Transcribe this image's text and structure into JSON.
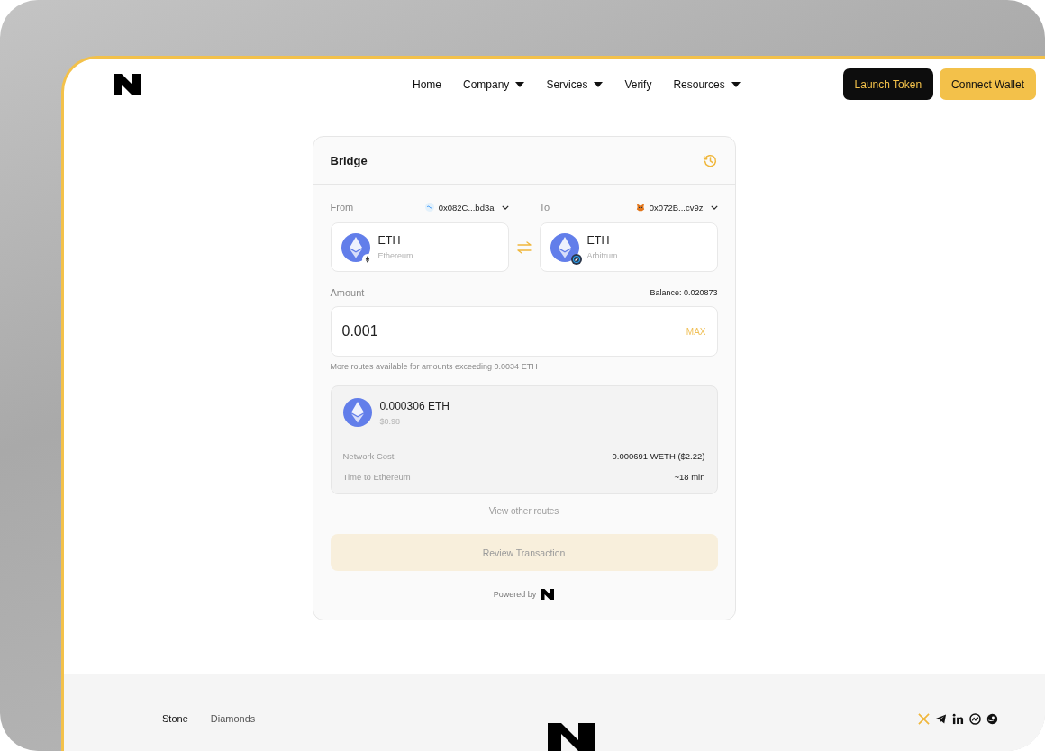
{
  "nav": {
    "items": [
      {
        "label": "Home",
        "has_menu": false
      },
      {
        "label": "Company",
        "has_menu": true
      },
      {
        "label": "Services",
        "has_menu": true
      },
      {
        "label": "Verify",
        "has_menu": false
      },
      {
        "label": "Resources",
        "has_menu": true
      }
    ],
    "buttons": [
      {
        "label": "Launch Token",
        "kind": "dark"
      },
      {
        "label": "Connect Wallet",
        "kind": "primary"
      }
    ]
  },
  "bridge": {
    "title": "Bridge",
    "from": {
      "label": "From",
      "wallet": {
        "address": "0x082C...bd3a",
        "kind": "wave"
      },
      "token": "ETH",
      "network": "Ethereum",
      "badge": {
        "kind": "ethereum"
      }
    },
    "to": {
      "label": "To",
      "wallet": {
        "address": "0x072B...cv9z",
        "kind": "fox"
      },
      "token": "ETH",
      "network": "Arbitrum",
      "badge": {
        "kind": "arbitrum"
      }
    },
    "amount_label": "Amount",
    "balance": "Balance:  0.020873",
    "amount": "0.001",
    "max": "MAX",
    "hint": "More routes available for amounts exceeding 0.0034 ETH",
    "route": {
      "amount": "0.000306 ETH",
      "usd": "$0.98",
      "details": [
        {
          "label": "Network Cost",
          "value": "0.000691 WETH ($2.22)"
        },
        {
          "label": "Time to Ethereum",
          "value": "~18 min"
        }
      ]
    },
    "other_routes": "View other routes",
    "review": {
      "label": "Review Transaction",
      "disabled": true
    },
    "powered_by": "Powered by"
  },
  "footer": {
    "links": [
      {
        "label": "Stone",
        "selected": true
      },
      {
        "label": "Diamonds",
        "selected": false
      }
    ],
    "socials": [
      {
        "kind": "x"
      },
      {
        "kind": "telegram"
      },
      {
        "kind": "linkedin"
      },
      {
        "kind": "coinmarketcap"
      },
      {
        "kind": "coingecko"
      }
    ]
  }
}
